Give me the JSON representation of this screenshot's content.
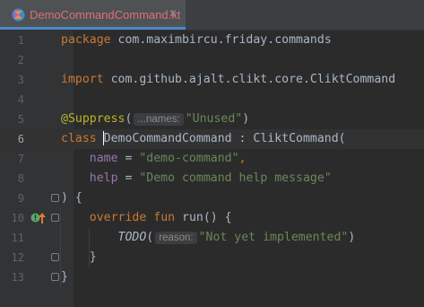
{
  "tab": {
    "filename": "DemoCommandCommand.kt",
    "close_glyph": "✕",
    "icon": "kotlin-file-icon"
  },
  "lines": [
    {
      "num": "1",
      "kw": "package",
      "text": " com.maximbircu.friday.commands"
    },
    {
      "num": "2"
    },
    {
      "num": "3",
      "kw": "import",
      "text": " com.github.ajalt.clikt.core.CliktCommand"
    },
    {
      "num": "4"
    },
    {
      "num": "5",
      "annotation": "@Suppress",
      "open": "(",
      "hint": "...names:",
      "string": "\"Unused\"",
      "close": ")"
    },
    {
      "num": "6",
      "kw": "class",
      "space": " ",
      "class_name": "DemoCommandCommand",
      "text": " : CliktCommand("
    },
    {
      "num": "7",
      "indent": "    ",
      "prop": "name",
      "eq": " = ",
      "string": "\"demo-command\"",
      "comma": ","
    },
    {
      "num": "8",
      "indent": "    ",
      "prop": "help",
      "eq": " = ",
      "string": "\"Demo command help message\""
    },
    {
      "num": "9",
      "text": ") {"
    },
    {
      "num": "10",
      "indent": "    ",
      "kw": "override",
      "space": " ",
      "kw2": "fun",
      "text": " run() {"
    },
    {
      "num": "11",
      "indent": "        ",
      "todo": "TODO",
      "open": "(",
      "hint": "reason:",
      "string": "\"Not yet implemented\"",
      "close": ")"
    },
    {
      "num": "12",
      "text": "    }"
    },
    {
      "num": "13",
      "text": "}"
    }
  ],
  "colors": {
    "background": "#2b2b2b",
    "keyword": "#cc7832",
    "string": "#6a8759",
    "annotation": "#bbb529",
    "property": "#9876aa",
    "tab_label": "#e06c75"
  },
  "gutter_icons": {
    "line10_run": "run-gutter-icon",
    "line10_override": "override-up-arrow-icon"
  }
}
